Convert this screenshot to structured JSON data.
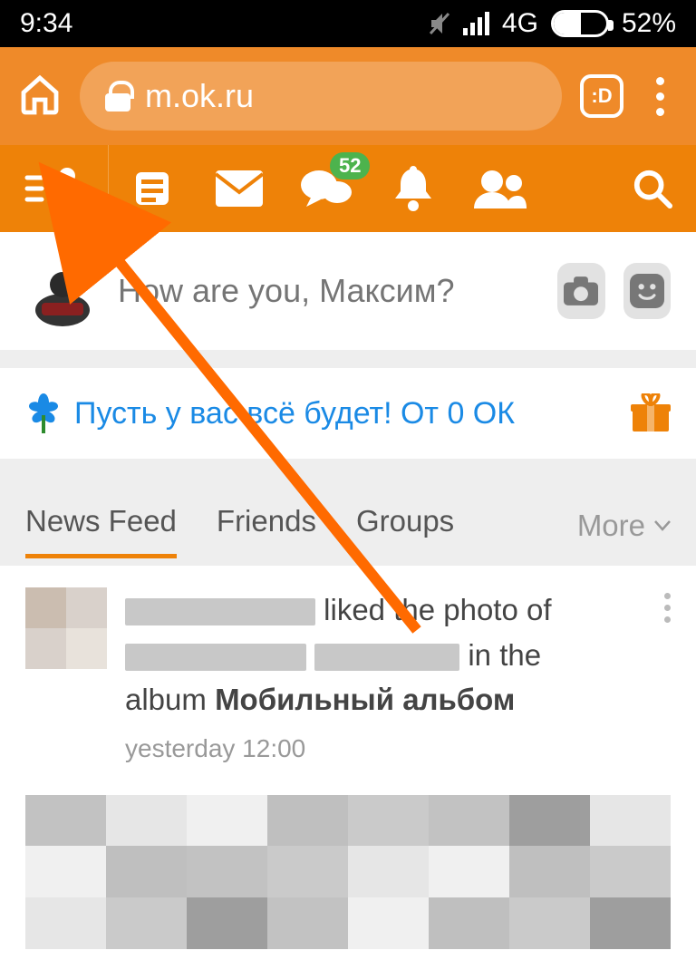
{
  "statusbar": {
    "time": "9:34",
    "network_label": "4G",
    "battery_pct": "52%"
  },
  "browser": {
    "url": "m.ok.ru",
    "tabs_label": ":D"
  },
  "oknav": {
    "messages_badge": "52"
  },
  "status_composer": {
    "placeholder": "How are you, Максим?"
  },
  "promo": {
    "text": "Пусть у вас всё будет! От 0 ОК"
  },
  "tabs": {
    "news": "News Feed",
    "friends": "Friends",
    "groups": "Groups",
    "more": "More"
  },
  "feed": {
    "item1": {
      "liked_text": " liked the photo of ",
      "in_the": " in the",
      "album_word": "album ",
      "album_name": "Мобильный альбом",
      "time": "yesterday 12:00"
    }
  }
}
